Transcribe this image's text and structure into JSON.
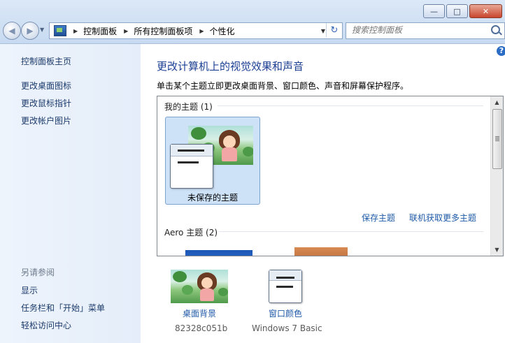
{
  "window": {
    "minimize_glyph": "—",
    "maximize_glyph": "□",
    "close_glyph": "✕"
  },
  "address_bar": {
    "breadcrumbs": [
      "控制面板",
      "所有控制面板项",
      "个性化"
    ],
    "separator": "▶",
    "refresh_glyph": "↻"
  },
  "search": {
    "placeholder": "搜索控制面板"
  },
  "left_pane": {
    "links": [
      "控制面板主页",
      "更改桌面图标",
      "更改鼠标指针",
      "更改帐户图片"
    ],
    "see_also_title": "另请参阅",
    "see_also_links": [
      "显示",
      "任务栏和「开始」菜单",
      "轻松访问中心"
    ]
  },
  "main": {
    "help_glyph": "?",
    "title": "更改计算机上的视觉效果和声音",
    "subtitle": "单击某个主题立即更改桌面背景、窗口颜色、声音和屏幕保护程序。",
    "my_themes_label": "我的主题 (1)",
    "unsaved_theme_name": "未保存的主题",
    "save_theme_link": "保存主题",
    "get_more_link": "联机获取更多主题",
    "aero_themes_label": "Aero 主题 (2)"
  },
  "bottom_tiles": {
    "desktop_background": {
      "label": "桌面背景",
      "value": "82328c051b"
    },
    "window_color": {
      "label": "窗口颜色",
      "value": "Windows 7 Basic"
    }
  },
  "colors": {
    "link": "#1f5aa8",
    "heading": "#1c3f94",
    "selected_theme_bg": "#cde1f7"
  }
}
